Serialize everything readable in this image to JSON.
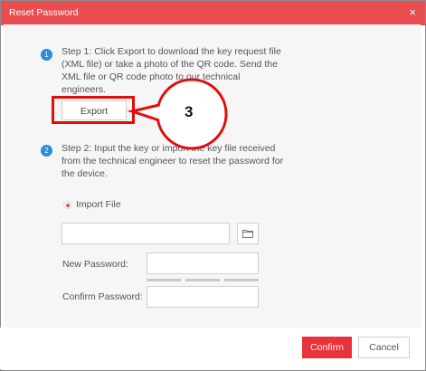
{
  "dialog": {
    "title": "Reset Password",
    "close_icon": "×"
  },
  "step1": {
    "badge": "1",
    "text": "Step 1: Click Export to download the key request file (XML file) or take a photo of the QR code. Send the XML file or QR code photo to our technical engineers.",
    "export_label": "Export"
  },
  "step2": {
    "badge": "2",
    "text": "Step 2: Input the key or import the key file received from the technical engineer to reset the password for the device.",
    "import_option": "Import File",
    "file_input_value": "",
    "new_password_label": "New Password:",
    "new_password_value": "",
    "confirm_password_label": "Confirm Password:",
    "confirm_password_value": ""
  },
  "footer": {
    "confirm_label": "Confirm",
    "cancel_label": "Cancel"
  },
  "annotation": {
    "callout_number": "3"
  },
  "colors": {
    "titlebar": "#e84d50",
    "accent_blue": "#2e8bd8",
    "confirm": "#e9323a",
    "annotation_red": "#e20d0d"
  },
  "icons": {
    "close": "close-icon",
    "browse": "folder-icon"
  }
}
